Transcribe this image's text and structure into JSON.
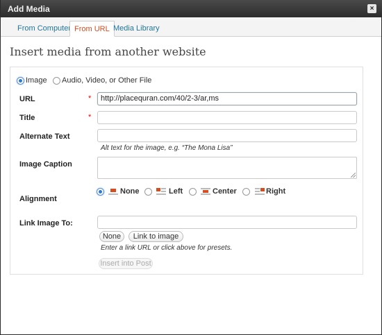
{
  "window": {
    "title": "Add Media",
    "close_glyph": "×"
  },
  "tabs": [
    {
      "label": "From Computer",
      "active": false
    },
    {
      "label": "From URL",
      "active": true
    },
    {
      "label": "Media Library",
      "active": false
    }
  ],
  "heading": "Insert media from another website",
  "media_type": {
    "options": [
      "Image",
      "Audio, Video, or Other File"
    ],
    "selected": "Image"
  },
  "fields": {
    "url": {
      "label": "URL",
      "required_mark": "*",
      "value": "http://placequran.com/40/2-3/ar,ms"
    },
    "title": {
      "label": "Title",
      "required_mark": "*",
      "value": ""
    },
    "alt": {
      "label": "Alternate Text",
      "value": "",
      "help": "Alt text for the image, e.g. “The Mona Lisa”"
    },
    "caption": {
      "label": "Image Caption",
      "value": ""
    },
    "alignment": {
      "label": "Alignment",
      "options": [
        "None",
        "Left",
        "Center",
        "Right"
      ],
      "selected": "None"
    },
    "link": {
      "label": "Link Image To:",
      "value": "",
      "preset_buttons": [
        "None",
        "Link to image"
      ],
      "help": "Enter a link URL or click above for presets."
    }
  },
  "submit_label": "Insert into Post",
  "colors": {
    "tab_link": "#21759b",
    "tab_active": "#d54e21",
    "radio_checked": "#2c7ac9",
    "required": "#e00000"
  }
}
